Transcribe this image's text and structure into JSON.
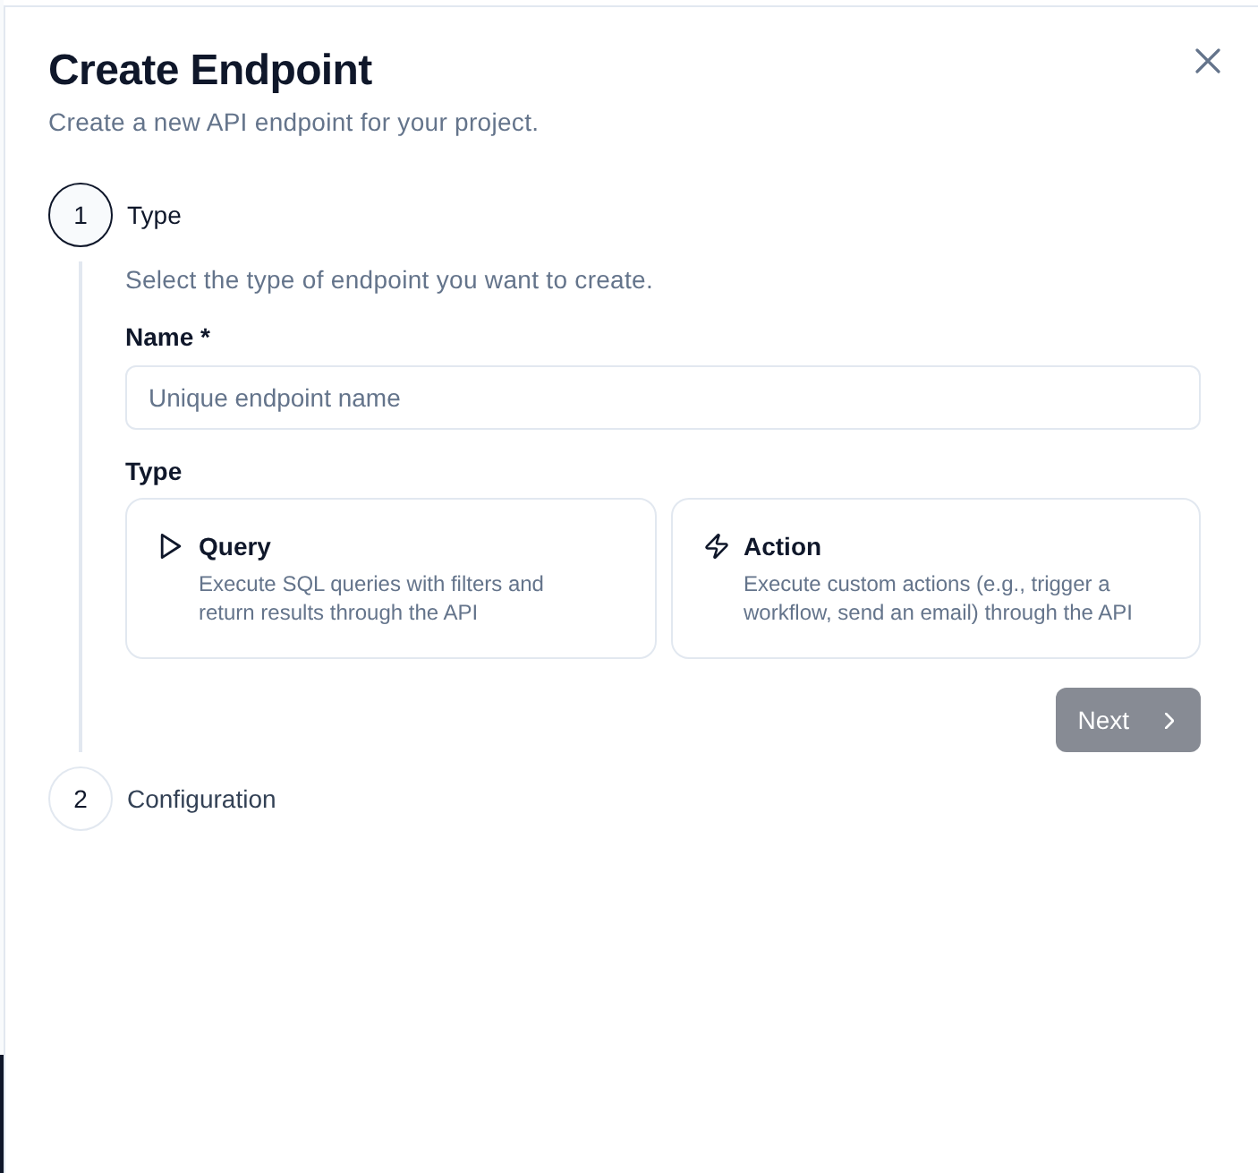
{
  "window": {
    "title": "Create Endpoint",
    "subtitle": "Create a new API endpoint for your project."
  },
  "steps": [
    {
      "number": "1",
      "label": "Type",
      "selected": true,
      "content": {
        "description": "Select the type of endpoint you want to create.",
        "name_field": {
          "label": "Name *",
          "placeholder": "Unique endpoint name"
        },
        "type_label": "Type",
        "type_options": [
          {
            "kind": "query",
            "title": "Query",
            "description": "Execute SQL queries with filters and return results through the API",
            "selected": false
          },
          {
            "kind": "action",
            "title": "Action",
            "description": "Execute custom actions (e.g., trigger a workflow, send an email) through the API",
            "selected": false
          }
        ],
        "next_button": {
          "label": "Next",
          "disabled": true
        }
      }
    },
    {
      "number": "2",
      "label": "Configuration",
      "selected": false
    }
  ]
}
